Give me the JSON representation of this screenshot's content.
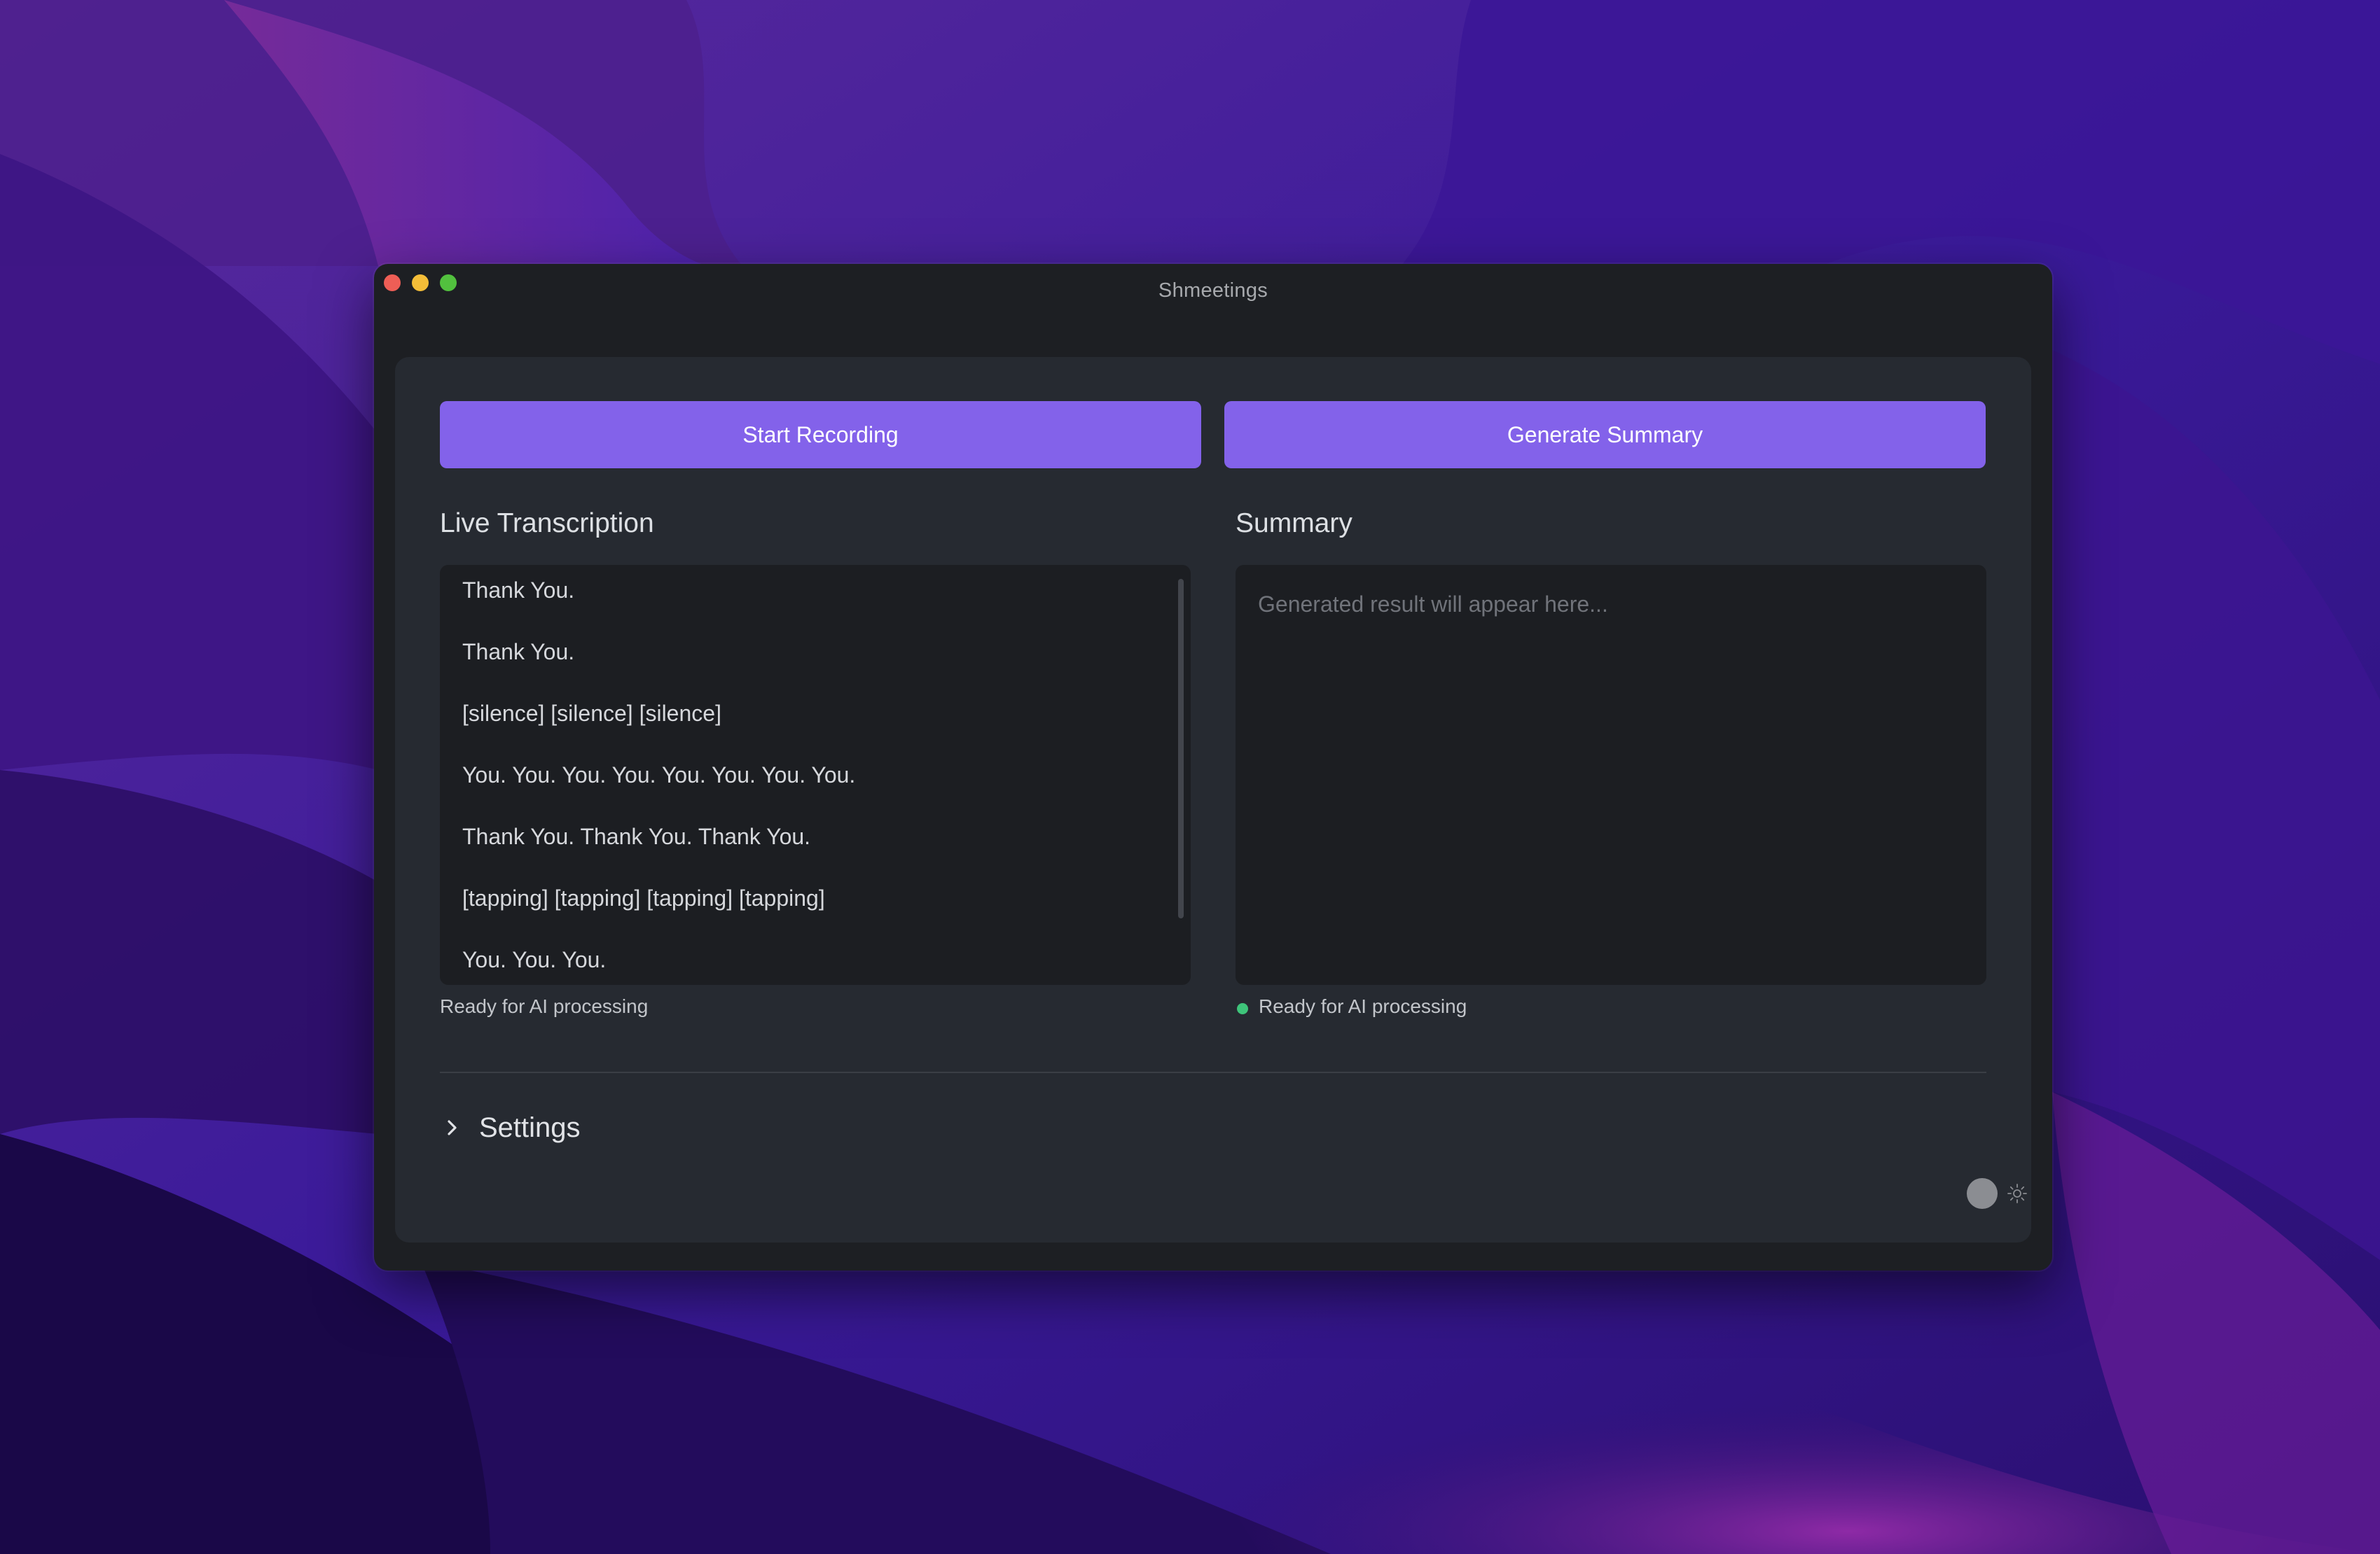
{
  "window": {
    "title": "Shmeetings"
  },
  "toolbar": {
    "start_recording_label": "Start Recording",
    "generate_summary_label": "Generate Summary"
  },
  "transcription": {
    "heading": "Live Transcription",
    "lines": [
      "Thank You.",
      "Thank You.",
      "[silence] [silence] [silence]",
      "You. You. You. You. You. You. You. You.",
      "Thank You. Thank You. Thank You.",
      "[tapping] [tapping] [tapping] [tapping]",
      "You. You. You."
    ],
    "status": "Ready for AI processing"
  },
  "summary": {
    "heading": "Summary",
    "placeholder": "Generated result will appear here...",
    "status": "Ready for AI processing"
  },
  "settings": {
    "label": "Settings",
    "icon": "chevron-right-icon"
  },
  "theme": {
    "icon": "sun-icon"
  },
  "colors": {
    "accent": "#8362ea",
    "status_ok": "#3ec47a",
    "window_bg": "#1d1f23",
    "panel_bg": "#262a31"
  }
}
